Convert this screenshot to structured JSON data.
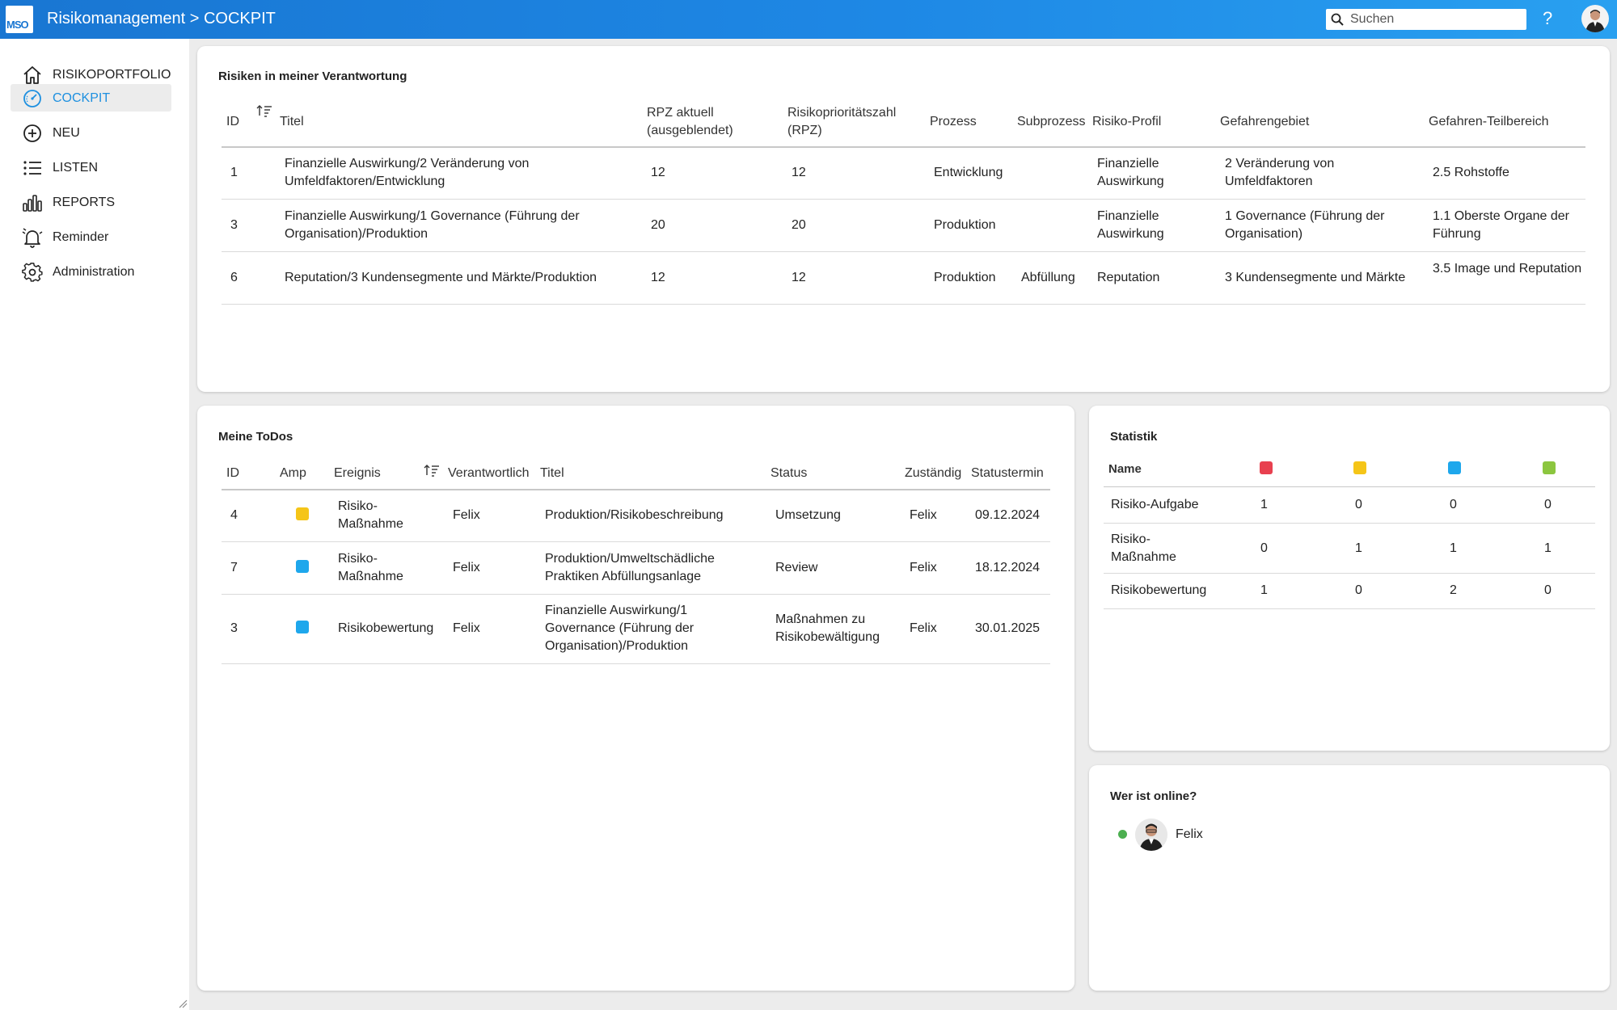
{
  "header": {
    "logo_text": "MSO",
    "title": "Risikomanagement > COCKPIT",
    "search_placeholder": "Suchen",
    "help_label": "?"
  },
  "sidebar": {
    "items": [
      {
        "label": "RISIKOPORTFOLIO",
        "icon": "home-icon"
      },
      {
        "label": "COCKPIT",
        "icon": "gauge-icon",
        "active": true
      },
      {
        "label": "NEU",
        "icon": "plus-circle-icon"
      },
      {
        "label": "LISTEN",
        "icon": "list-icon"
      },
      {
        "label": "REPORTS",
        "icon": "bar-chart-icon"
      },
      {
        "label": "Reminder",
        "icon": "bell-icon"
      },
      {
        "label": "Administration",
        "icon": "gear-icon"
      }
    ]
  },
  "risks": {
    "title": "Risiken in meiner Verantwortung",
    "columns": {
      "id": "ID",
      "titel": "Titel",
      "rpz_aktuell": "RPZ aktuell (ausgeblendet)",
      "rpz": "Risikoprioritätszahl (RPZ)",
      "prozess": "Prozess",
      "subprozess": "Subprozess",
      "profil": "Risiko-Profil",
      "gebiet": "Gefahrengebiet",
      "teilbereich": "Gefahren-Teilbereich"
    },
    "rows": [
      {
        "id": "1",
        "titel": "Finanzielle Auswirkung/2 Veränderung von Umfeldfaktoren/Entwicklung",
        "rpz_aktuell": "12",
        "rpz": "12",
        "prozess": "Entwicklung",
        "subprozess": "",
        "profil": "Finanzielle Auswirkung",
        "gebiet": "2 Veränderung von Umfeldfaktoren",
        "teilbereich": "2.5 Rohstoffe"
      },
      {
        "id": "3",
        "titel": "Finanzielle Auswirkung/1 Governance (Führung der Organisation)/Produktion",
        "rpz_aktuell": "20",
        "rpz": "20",
        "prozess": "Produktion",
        "subprozess": "",
        "profil": "Finanzielle Auswirkung",
        "gebiet": "1 Governance (Führung der Organisation)",
        "teilbereich": "1.1 Oberste Organe der Führung"
      },
      {
        "id": "6",
        "titel": "Reputation/3 Kundensegmente und Märkte/Produktion",
        "rpz_aktuell": "12",
        "rpz": "12",
        "prozess": "Produktion",
        "subprozess": "Abfüllung",
        "profil": "Reputation",
        "gebiet": "3 Kundensegmente und Märkte",
        "teilbereich": "3.5 Image und Reputation"
      }
    ]
  },
  "todos": {
    "title": "Meine ToDos",
    "columns": {
      "id": "ID",
      "amp": "Amp",
      "ereignis": "Ereignis",
      "verantwortlich": "Verantwortlich",
      "titel": "Titel",
      "status": "Status",
      "zustaendig": "Zuständig",
      "statustermin": "Statustermin"
    },
    "rows": [
      {
        "id": "4",
        "amp_color": "#f5c518",
        "ereignis": "Risiko-Maßnahme",
        "verantwortlich": "Felix",
        "titel": "Produktion/Risikobeschreibung",
        "status": "Umsetzung",
        "zustaendig": "Felix",
        "statustermin": "09.12.2024"
      },
      {
        "id": "7",
        "amp_color": "#1ea7ec",
        "ereignis": "Risiko-Maßnahme",
        "verantwortlich": "Felix",
        "titel": "Produktion/Umweltschädliche Praktiken Abfüllungsanlage",
        "status": "Review",
        "zustaendig": "Felix",
        "statustermin": "18.12.2024"
      },
      {
        "id": "3",
        "amp_color": "#1ea7ec",
        "ereignis": "Risikobewertung",
        "verantwortlich": "Felix",
        "titel": "Finanzielle Auswirkung/1 Governance (Führung der Organisation)/Produktion",
        "status": "Maßnahmen zu Risikobewältigung",
        "zustaendig": "Felix",
        "statustermin": "30.01.2025"
      }
    ]
  },
  "statistik": {
    "title": "Statistik",
    "name_header": "Name",
    "colors": [
      "#e8404f",
      "#f5c518",
      "#1ea7ec",
      "#8cc63f"
    ],
    "rows": [
      {
        "name": "Risiko-Aufgabe",
        "values": [
          "1",
          "0",
          "0",
          "0"
        ]
      },
      {
        "name": "Risiko-Maßnahme",
        "values": [
          "0",
          "1",
          "1",
          "1"
        ]
      },
      {
        "name": "Risikobewertung",
        "values": [
          "1",
          "0",
          "2",
          "0"
        ]
      }
    ]
  },
  "online": {
    "title": "Wer ist online?",
    "users": [
      {
        "name": "Felix"
      }
    ]
  }
}
